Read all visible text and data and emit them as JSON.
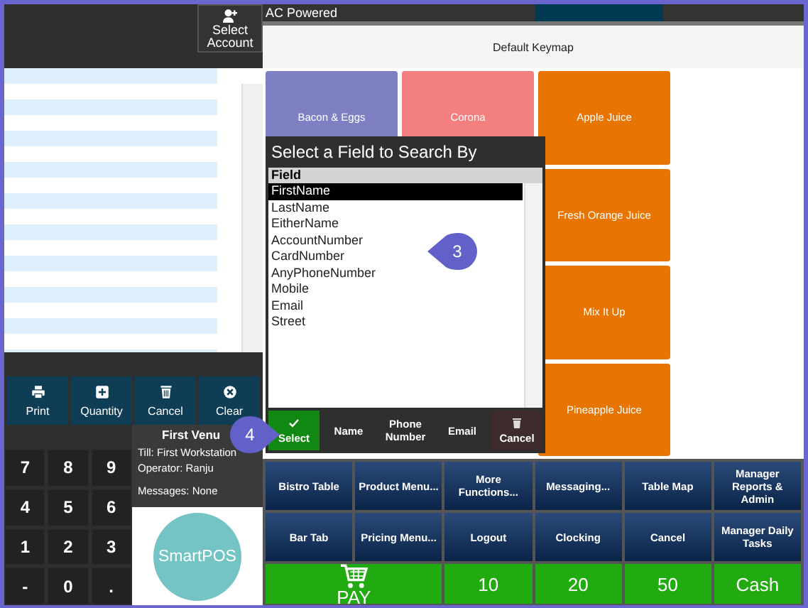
{
  "status_bar": {
    "text": "AC Powered"
  },
  "account_button": {
    "label": "Select Account"
  },
  "action_buttons": [
    {
      "label": "Print"
    },
    {
      "label": "Quantity"
    },
    {
      "label": "Cancel"
    },
    {
      "label": "Clear"
    }
  ],
  "venue": {
    "name": "First Venu",
    "till": "Till: First Workstation",
    "operator": "Operator: Ranju",
    "messages": "Messages: None"
  },
  "keypad": [
    "7",
    "8",
    "9",
    "4",
    "5",
    "6",
    "1",
    "2",
    "3",
    "-",
    "0",
    "."
  ],
  "logo": {
    "text": "SmartPOS"
  },
  "keymap": {
    "title": "Default Keymap",
    "keys": [
      {
        "label": "Bacon & Eggs",
        "color": "#7f7fc4"
      },
      {
        "label": "Corona",
        "color": "#f47f7f"
      },
      {
        "label": "Apple Juice",
        "color": "#e87502"
      },
      {
        "label": "Fresh Orange Juice",
        "color": "#e87502"
      },
      {
        "label": "Mix It Up",
        "color": "#e87502"
      },
      {
        "label": "Pineapple Juice",
        "color": "#e87502"
      }
    ]
  },
  "dialog": {
    "title": "Select a Field to Search By",
    "column": "Field",
    "fields": [
      {
        "label": "FirstName",
        "selected": true
      },
      {
        "label": "LastName",
        "selected": false
      },
      {
        "label": "EitherName",
        "selected": false
      },
      {
        "label": "AccountNumber",
        "selected": false
      },
      {
        "label": "CardNumber",
        "selected": false
      },
      {
        "label": "AnyPhoneNumber",
        "selected": false
      },
      {
        "label": "Mobile",
        "selected": false
      },
      {
        "label": "Email",
        "selected": false
      },
      {
        "label": "Street",
        "selected": false
      }
    ],
    "buttons": [
      {
        "label": "Select",
        "kind": "primary"
      },
      {
        "label": "Name",
        "kind": "plain"
      },
      {
        "label": "Phone Number",
        "kind": "plain"
      },
      {
        "label": "Email",
        "kind": "plain"
      },
      {
        "label": "Cancel",
        "kind": "cancel"
      }
    ]
  },
  "function_buttons": [
    {
      "label": "Bistro Table",
      "kind": "menu"
    },
    {
      "label": "Product Menu...",
      "kind": "menu"
    },
    {
      "label": "More Functions...",
      "kind": "menu"
    },
    {
      "label": "Messaging...",
      "kind": "menu"
    },
    {
      "label": "Table Map",
      "kind": "menu"
    },
    {
      "label": "Manager Reports & Admin",
      "kind": "menu"
    },
    {
      "label": "Bar Tab",
      "kind": "menu"
    },
    {
      "label": "Pricing Menu...",
      "kind": "menu"
    },
    {
      "label": "Logout",
      "kind": "menu"
    },
    {
      "label": "Clocking",
      "kind": "menu"
    },
    {
      "label": "Cancel",
      "kind": "menu"
    },
    {
      "label": "Manager Daily Tasks",
      "kind": "menu"
    },
    {
      "label": "PAY",
      "kind": "pay"
    },
    {
      "label": "10",
      "kind": "tender"
    },
    {
      "label": "20",
      "kind": "tender"
    },
    {
      "label": "50",
      "kind": "tender"
    },
    {
      "label": "Cash",
      "kind": "tender"
    }
  ],
  "callouts": [
    {
      "label": "3"
    },
    {
      "label": "4"
    }
  ]
}
